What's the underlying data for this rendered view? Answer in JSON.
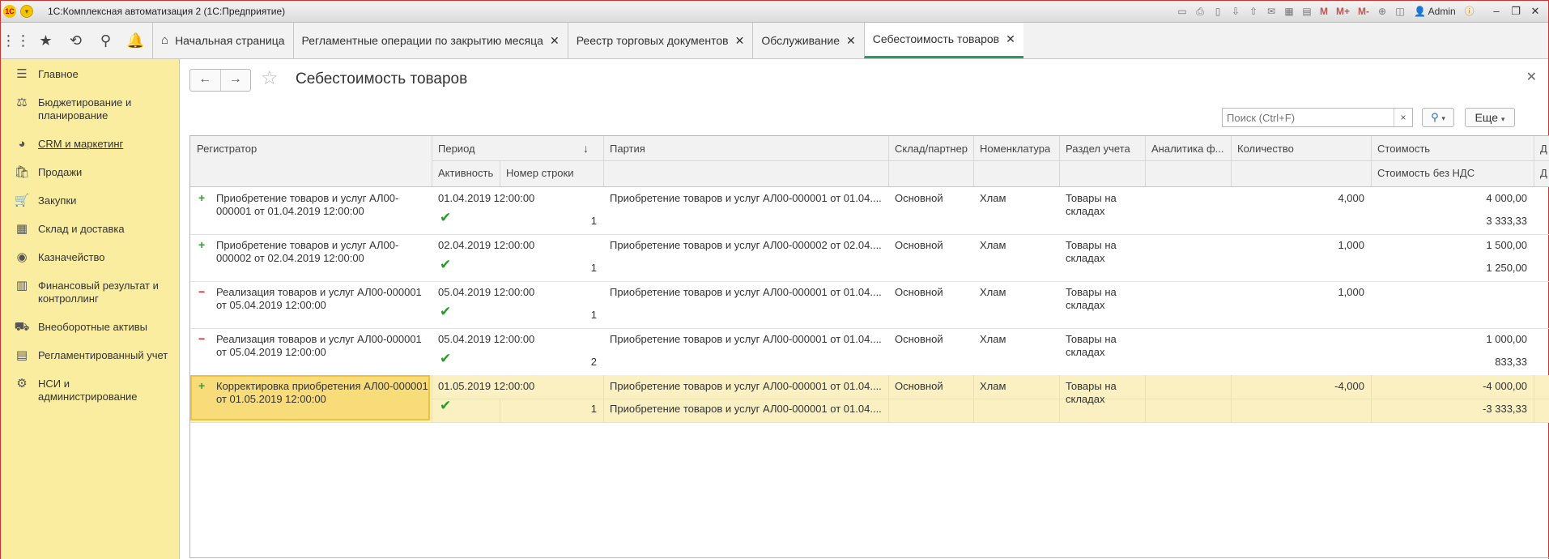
{
  "titlebar": {
    "logo": "1С",
    "title": "1С:Комплексная автоматизация 2  (1С:Предприятие)",
    "m": "M",
    "m_plus": "M+",
    "m_minus": "M-",
    "user": "Admin"
  },
  "tabs": [
    {
      "label": "Начальная страница",
      "closable": false
    },
    {
      "label": "Регламентные операции по закрытию месяца",
      "closable": true
    },
    {
      "label": "Реестр торговых документов",
      "closable": true
    },
    {
      "label": "Обслуживание",
      "closable": true
    },
    {
      "label": "Себестоимость товаров",
      "closable": true,
      "active": true
    }
  ],
  "sidebar": {
    "items": [
      {
        "label": "Главное",
        "icon": "list-icon"
      },
      {
        "label": "Бюджетирование и планирование",
        "icon": "budget-icon"
      },
      {
        "label": "CRM и маркетинг",
        "icon": "pie-icon"
      },
      {
        "label": "Продажи",
        "icon": "bag-icon"
      },
      {
        "label": "Закупки",
        "icon": "cart-icon"
      },
      {
        "label": "Склад и доставка",
        "icon": "grid-icon"
      },
      {
        "label": "Казначейство",
        "icon": "coin-icon"
      },
      {
        "label": "Финансовый результат и контроллинг",
        "icon": "chart-icon"
      },
      {
        "label": "Внеоборотные активы",
        "icon": "truck-icon"
      },
      {
        "label": "Регламентированный учет",
        "icon": "doc-icon"
      },
      {
        "label": "НСИ и администрирование",
        "icon": "gear-icon"
      }
    ]
  },
  "form": {
    "title": "Себестоимость товаров",
    "search_placeholder": "Поиск (Ctrl+F)",
    "clear": "×",
    "more": "Еще"
  },
  "columns": {
    "registrar": "Регистратор",
    "period": "Период",
    "sort_arrow": "↓",
    "activity": "Активность",
    "line_no": "Номер строки",
    "batch": "Партия",
    "warehouse": "Склад/партнер",
    "nomenclature": "Номенклатура",
    "section": "Раздел учета",
    "analytics": "Аналитика ф...",
    "quantity": "Количество",
    "cost": "Стоимость",
    "cost_no_vat": "Стоимость без НДС",
    "extra": "Д"
  },
  "rows": [
    {
      "sign": "+",
      "registrar": "Приобретение товаров и услуг АЛ00-000001 от 01.04.2019 12:00:00",
      "period": "01.04.2019 12:00:00",
      "line_no": "1",
      "batch": "Приобретение товаров и услуг АЛ00-000001 от 01.04....",
      "batch2": "",
      "warehouse": "Основной",
      "nomenclature": "Хлам",
      "section": "Товары на складах",
      "quantity": "4,000",
      "cost": "4 000,00",
      "cost_no_vat": "3 333,33"
    },
    {
      "sign": "+",
      "registrar": "Приобретение товаров и услуг АЛ00-000002 от 02.04.2019 12:00:00",
      "period": "02.04.2019 12:00:00",
      "line_no": "1",
      "batch": "Приобретение товаров и услуг АЛ00-000002 от 02.04....",
      "batch2": "",
      "warehouse": "Основной",
      "nomenclature": "Хлам",
      "section": "Товары на складах",
      "quantity": "1,000",
      "cost": "1 500,00",
      "cost_no_vat": "1 250,00"
    },
    {
      "sign": "−",
      "registrar": "Реализация товаров и услуг АЛ00-000001 от 05.04.2019 12:00:00",
      "period": "05.04.2019 12:00:00",
      "line_no": "1",
      "batch": "Приобретение товаров и услуг АЛ00-000001 от 01.04....",
      "batch2": "",
      "warehouse": "Основной",
      "nomenclature": "Хлам",
      "section": "Товары на складах",
      "quantity": "1,000",
      "cost": "",
      "cost_no_vat": ""
    },
    {
      "sign": "−",
      "registrar": "Реализация товаров и услуг АЛ00-000001 от 05.04.2019 12:00:00",
      "period": "05.04.2019 12:00:00",
      "line_no": "2",
      "batch": "Приобретение товаров и услуг АЛ00-000001 от 01.04....",
      "batch2": "",
      "warehouse": "Основной",
      "nomenclature": "Хлам",
      "section": "Товары на складах",
      "quantity": "",
      "cost": "1 000,00",
      "cost_no_vat": "833,33"
    },
    {
      "sign": "+",
      "registrar": "Корректировка приобретения АЛ00-000001 от 01.05.2019 12:00:00",
      "period": "01.05.2019 12:00:00",
      "line_no": "1",
      "batch": "Приобретение товаров и услуг АЛ00-000001 от 01.04....",
      "batch2": "Приобретение товаров и услуг АЛ00-000001 от 01.04....",
      "warehouse": "Основной",
      "nomenclature": "Хлам",
      "section": "Товары на складах",
      "quantity": "-4,000",
      "cost": "-4 000,00",
      "cost_no_vat": "-3 333,33",
      "selected": true
    }
  ],
  "colors": {
    "sidebar": "#faeda0",
    "active_tab": "#2a9a6a",
    "selected_row": "#fbf0c2",
    "plus": "#3a9a3a",
    "minus": "#c82828"
  }
}
